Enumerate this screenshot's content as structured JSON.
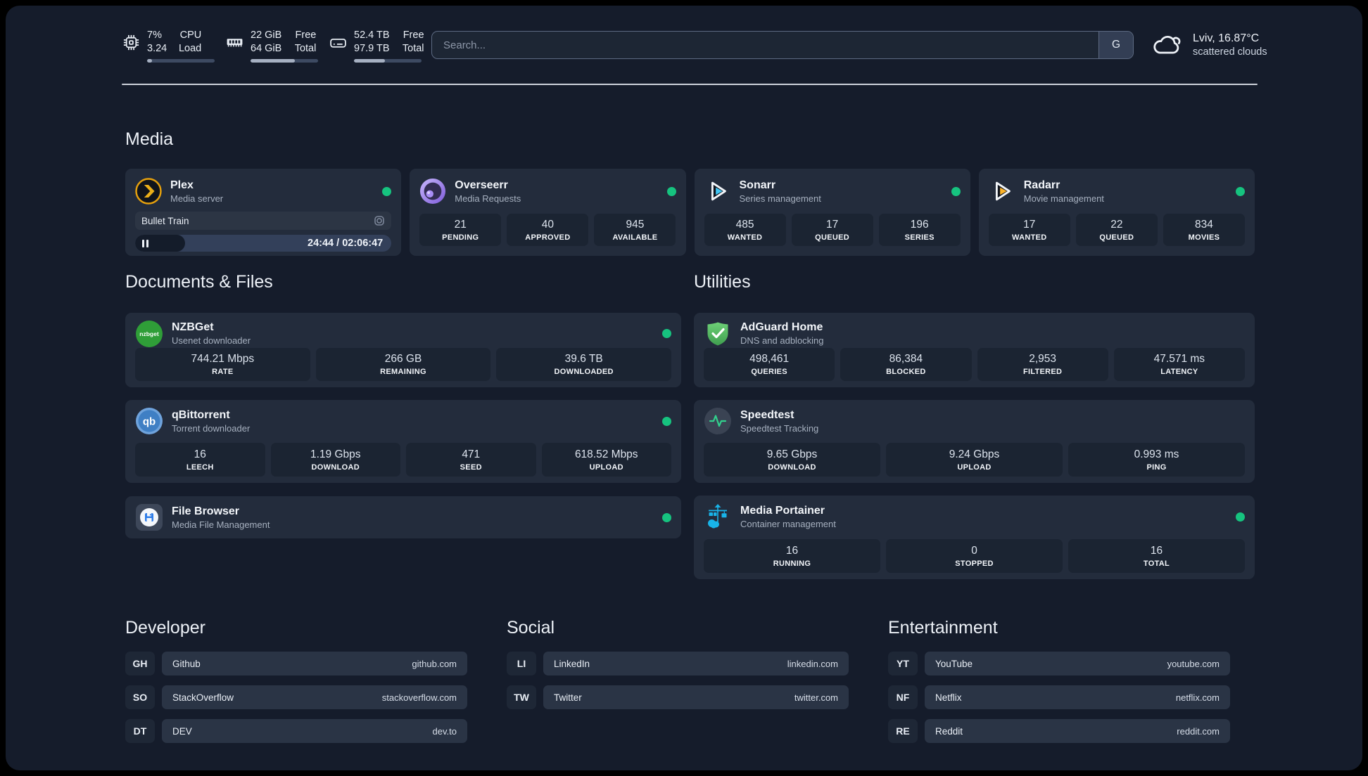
{
  "header": {
    "stats": [
      {
        "icon": "cpu",
        "values": [
          "7%",
          "3.24"
        ],
        "labels": [
          "CPU",
          "Load"
        ],
        "progress": 7
      },
      {
        "icon": "memory",
        "values": [
          "22 GiB",
          "64 GiB"
        ],
        "labels": [
          "Free",
          "Total"
        ],
        "progress": 66
      },
      {
        "icon": "storage",
        "values": [
          "52.4 TB",
          "97.9 TB"
        ],
        "labels": [
          "Free",
          "Total"
        ],
        "progress": 46
      }
    ],
    "search": {
      "placeholder": "Search...",
      "engine": "G"
    },
    "weather": {
      "location": "Lviv, 16.87°C",
      "condition": "scattered clouds"
    }
  },
  "media": {
    "title": "Media",
    "cards": [
      {
        "name": "Plex",
        "subtitle": "Media server",
        "online": true,
        "player": {
          "track": "Bullet Train",
          "time": "24:44 / 02:06:47",
          "progress": 19.5
        }
      },
      {
        "name": "Overseerr",
        "subtitle": "Media Requests",
        "online": true,
        "stats": [
          {
            "value": "21",
            "label": "PENDING"
          },
          {
            "value": "40",
            "label": "APPROVED"
          },
          {
            "value": "945",
            "label": "AVAILABLE"
          }
        ]
      },
      {
        "name": "Sonarr",
        "subtitle": "Series management",
        "online": true,
        "stats": [
          {
            "value": "485",
            "label": "WANTED"
          },
          {
            "value": "17",
            "label": "QUEUED"
          },
          {
            "value": "196",
            "label": "SERIES"
          }
        ]
      },
      {
        "name": "Radarr",
        "subtitle": "Movie management",
        "online": true,
        "stats": [
          {
            "value": "17",
            "label": "WANTED"
          },
          {
            "value": "22",
            "label": "QUEUED"
          },
          {
            "value": "834",
            "label": "MOVIES"
          }
        ]
      }
    ]
  },
  "documents": {
    "title": "Documents & Files",
    "cards": [
      {
        "name": "NZBGet",
        "subtitle": "Usenet downloader",
        "online": true,
        "stats": [
          {
            "value": "744.21 Mbps",
            "label": "RATE"
          },
          {
            "value": "266 GB",
            "label": "REMAINING"
          },
          {
            "value": "39.6 TB",
            "label": "DOWNLOADED"
          }
        ]
      },
      {
        "name": "qBittorrent",
        "subtitle": "Torrent downloader",
        "online": true,
        "stats": [
          {
            "value": "16",
            "label": "LEECH"
          },
          {
            "value": "1.19 Gbps",
            "label": "DOWNLOAD"
          },
          {
            "value": "471",
            "label": "SEED"
          },
          {
            "value": "618.52 Mbps",
            "label": "UPLOAD"
          }
        ]
      },
      {
        "name": "File Browser",
        "subtitle": "Media File Management",
        "online": true,
        "stats": []
      }
    ]
  },
  "utilities": {
    "title": "Utilities",
    "cards": [
      {
        "name": "AdGuard Home",
        "subtitle": "DNS and adblocking",
        "stats": [
          {
            "value": "498,461",
            "label": "QUERIES"
          },
          {
            "value": "86,384",
            "label": "BLOCKED"
          },
          {
            "value": "2,953",
            "label": "FILTERED"
          },
          {
            "value": "47.571 ms",
            "label": "LATENCY"
          }
        ]
      },
      {
        "name": "Speedtest",
        "subtitle": "Speedtest Tracking",
        "stats": [
          {
            "value": "9.65 Gbps",
            "label": "DOWNLOAD"
          },
          {
            "value": "9.24 Gbps",
            "label": "UPLOAD"
          },
          {
            "value": "0.993 ms",
            "label": "PING"
          }
        ]
      },
      {
        "name": "Media Portainer",
        "subtitle": "Container management",
        "online": true,
        "stats": [
          {
            "value": "16",
            "label": "RUNNING"
          },
          {
            "value": "0",
            "label": "STOPPED"
          },
          {
            "value": "16",
            "label": "TOTAL"
          }
        ]
      }
    ]
  },
  "bookmarks": {
    "groups": [
      {
        "title": "Developer",
        "links": [
          {
            "abbr": "GH",
            "name": "Github",
            "url": "github.com"
          },
          {
            "abbr": "SO",
            "name": "StackOverflow",
            "url": "stackoverflow.com"
          },
          {
            "abbr": "DT",
            "name": "DEV",
            "url": "dev.to"
          }
        ]
      },
      {
        "title": "Social",
        "links": [
          {
            "abbr": "LI",
            "name": "LinkedIn",
            "url": "linkedin.com"
          },
          {
            "abbr": "TW",
            "name": "Twitter",
            "url": "twitter.com"
          }
        ]
      },
      {
        "title": "Entertainment",
        "links": [
          {
            "abbr": "YT",
            "name": "YouTube",
            "url": "youtube.com"
          },
          {
            "abbr": "NF",
            "name": "Netflix",
            "url": "netflix.com"
          },
          {
            "abbr": "RE",
            "name": "Reddit",
            "url": "reddit.com"
          }
        ]
      }
    ]
  },
  "colors": {
    "status_online": "#16c37f",
    "accent_blue": "#18b4e9"
  }
}
